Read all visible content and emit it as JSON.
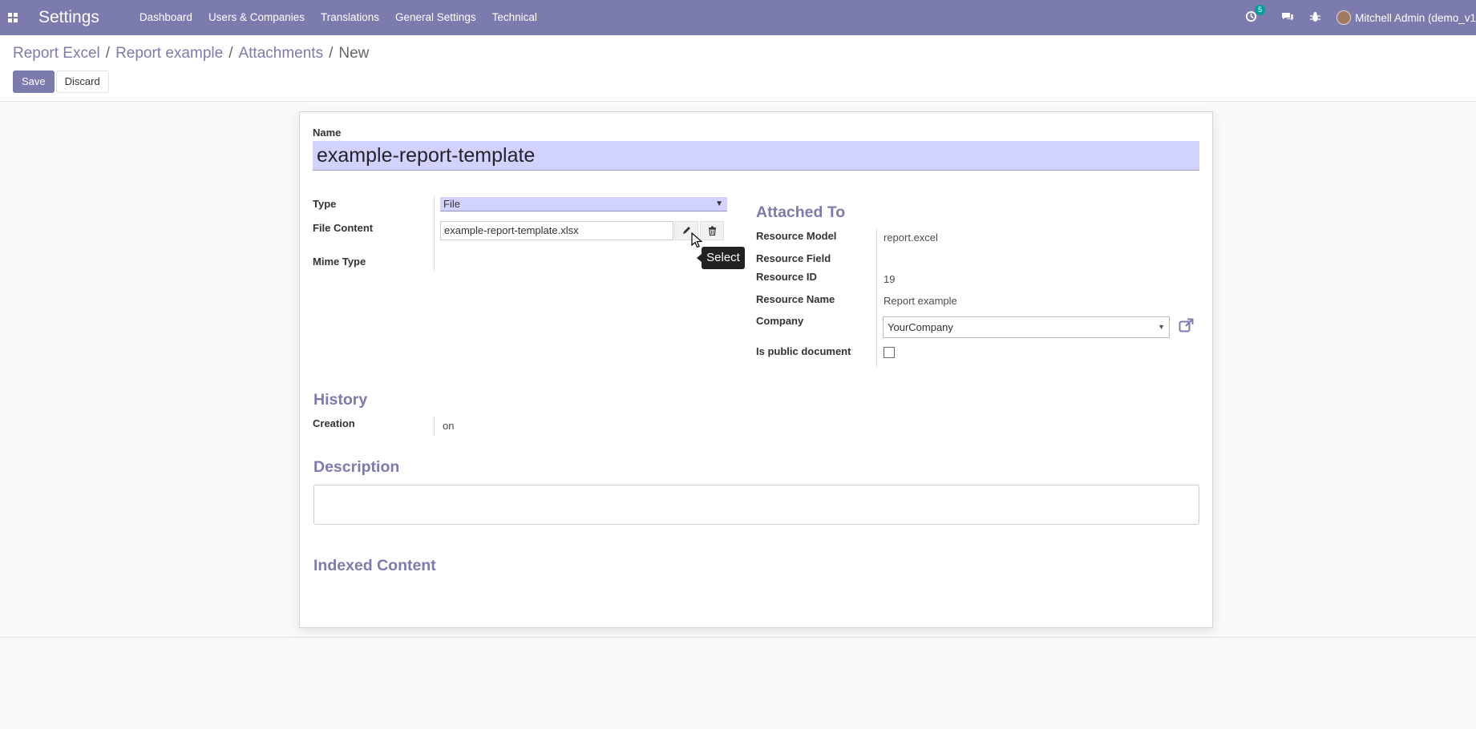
{
  "navbar": {
    "app_title": "Settings",
    "menu": [
      "Dashboard",
      "Users & Companies",
      "Translations",
      "General Settings",
      "Technical"
    ],
    "activity_count": "5",
    "user_name": "Mitchell Admin (demo_v1"
  },
  "breadcrumb": [
    "Report Excel",
    "Report example",
    "Attachments",
    "New"
  ],
  "buttons": {
    "save": "Save",
    "discard": "Discard"
  },
  "form": {
    "name_label": "Name",
    "name_value": "example-report-template",
    "type_label": "Type",
    "type_value": "File",
    "file_content_label": "File Content",
    "file_content_value": "example-report-template.xlsx",
    "mime_type_label": "Mime Type",
    "attached_to_title": "Attached To",
    "resource_model_label": "Resource Model",
    "resource_model_value": "report.excel",
    "resource_field_label": "Resource Field",
    "resource_id_label": "Resource ID",
    "resource_id_value": "19",
    "resource_name_label": "Resource Name",
    "resource_name_value": "Report example",
    "company_label": "Company",
    "company_value": "YourCompany",
    "is_public_label": "Is public document",
    "history_title": "History",
    "creation_label": "Creation",
    "creation_value": "on",
    "description_title": "Description",
    "indexed_content_title": "Indexed Content"
  },
  "tooltip": "Select",
  "colors": {
    "brand": "#7c7bad",
    "required_field": "#d2d2ff"
  }
}
